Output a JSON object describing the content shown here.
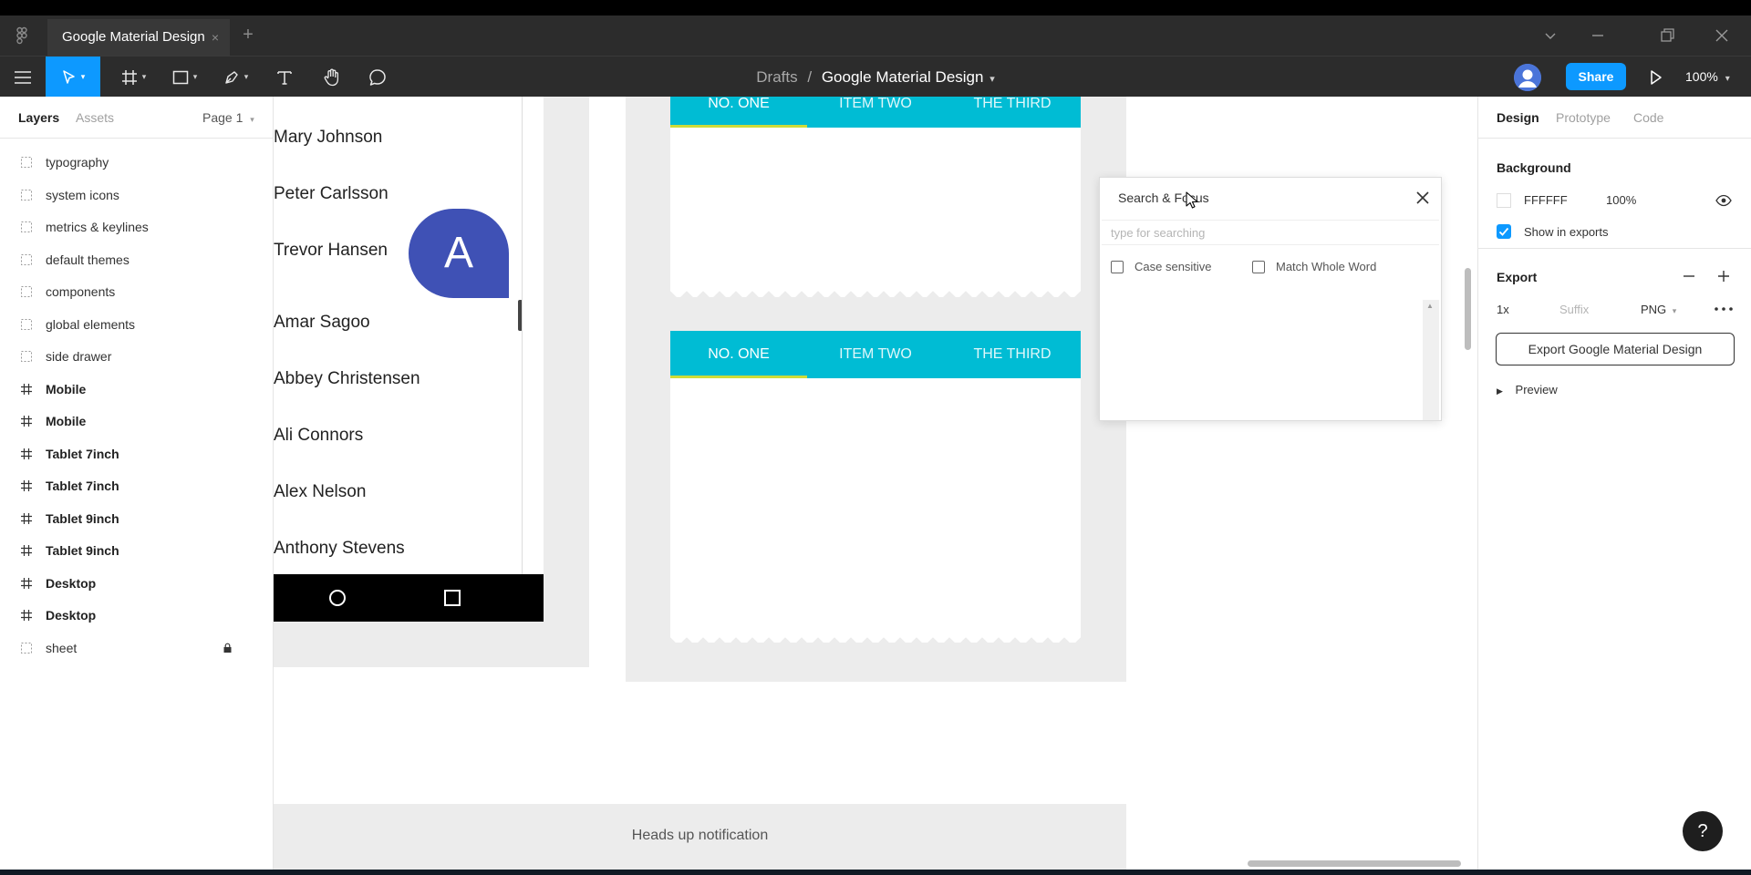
{
  "titlebar": {
    "tab_title": "Google Material Design",
    "tab_close": "×",
    "new_tab": "+"
  },
  "toolbar": {
    "breadcrumb_parent": "Drafts",
    "breadcrumb_sep": "/",
    "file_name": "Google Material Design",
    "share_label": "Share",
    "zoom_level": "100%"
  },
  "left_panel": {
    "tabs": {
      "layers": "Layers",
      "assets": "Assets"
    },
    "page_label": "Page 1",
    "layers": [
      {
        "label": "typography",
        "type": "section"
      },
      {
        "label": "system icons",
        "type": "section"
      },
      {
        "label": "metrics & keylines",
        "type": "section"
      },
      {
        "label": "default themes",
        "type": "section"
      },
      {
        "label": "components",
        "type": "section"
      },
      {
        "label": "global elements",
        "type": "section"
      },
      {
        "label": "side drawer",
        "type": "section"
      },
      {
        "label": "Mobile",
        "type": "frame"
      },
      {
        "label": "Mobile",
        "type": "frame"
      },
      {
        "label": "Tablet 7inch",
        "type": "frame"
      },
      {
        "label": "Tablet 7inch",
        "type": "frame"
      },
      {
        "label": "Tablet 9inch",
        "type": "frame"
      },
      {
        "label": "Tablet 9inch",
        "type": "frame"
      },
      {
        "label": "Desktop",
        "type": "frame"
      },
      {
        "label": "Desktop",
        "type": "frame"
      },
      {
        "label": "sheet",
        "type": "section",
        "locked": true
      }
    ]
  },
  "canvas": {
    "contacts": [
      "Mary Johnson",
      "Peter Carlsson",
      "Trevor Hansen",
      "Amar Sagoo",
      "Abbey Christensen",
      "Ali Connors",
      "Alex Nelson",
      "Anthony Stevens"
    ],
    "fab_letter": "A",
    "tabs_top": [
      "NO. ONE",
      "ITEM TWO",
      "THE THIRD"
    ],
    "tabs_bottom": [
      "NO. ONE",
      "ITEM TWO",
      "THE THIRD"
    ],
    "notification_label": "Heads up notification",
    "colors": {
      "tab_bar": "#00bcd4",
      "tab_indicator": "#cddc39",
      "fab": "#3f51b5"
    }
  },
  "search_dialog": {
    "title": "Search & Focus",
    "input_placeholder": "type for searching",
    "case_sensitive_label": "Case sensitive",
    "match_whole_word_label": "Match Whole Word"
  },
  "right_panel": {
    "tabs": {
      "design": "Design",
      "prototype": "Prototype",
      "code": "Code"
    },
    "background_heading": "Background",
    "background_hex": "FFFFFF",
    "background_opacity": "100%",
    "show_in_exports_label": "Show in exports",
    "show_in_exports_checked": true,
    "export_heading": "Export",
    "export_scale": "1x",
    "export_suffix_placeholder": "Suffix",
    "export_format": "PNG",
    "export_button_label": "Export Google Material Design",
    "preview_label": "Preview"
  },
  "help_label": "?",
  "brand_color": "#0d99ff"
}
